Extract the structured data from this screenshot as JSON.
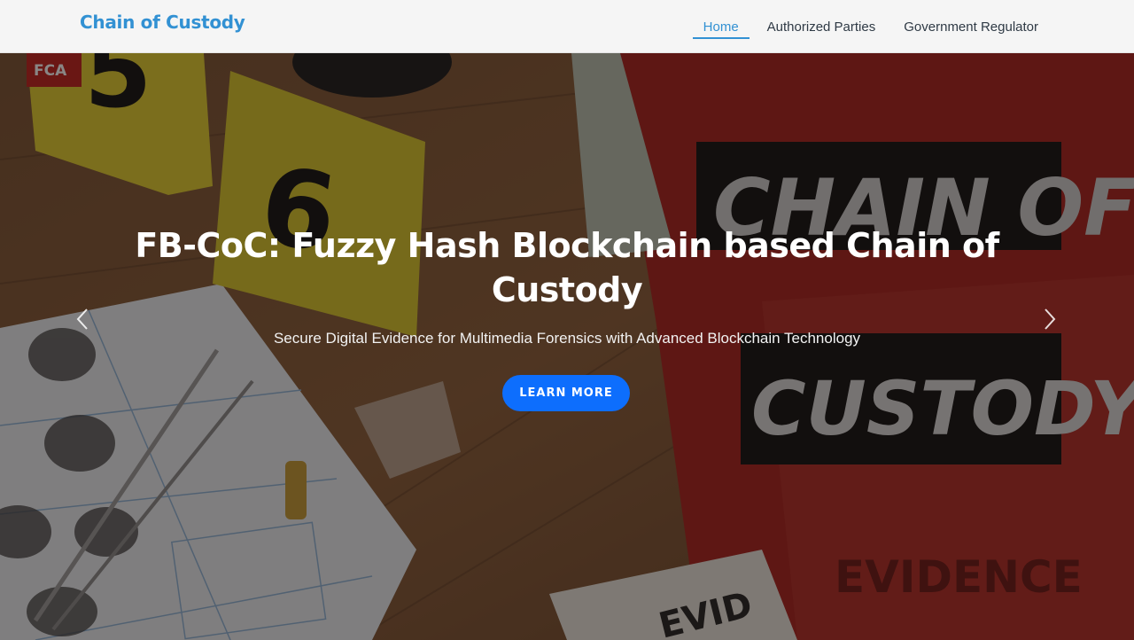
{
  "navbar": {
    "brand": "Chain of Custody",
    "links": [
      {
        "label": "Home",
        "active": true
      },
      {
        "label": "Authorized Parties",
        "active": false
      },
      {
        "label": "Government Regulator",
        "active": false
      }
    ]
  },
  "hero": {
    "title": "FB-CoC: Fuzzy Hash Blockchain based Chain of Custody",
    "subtitle": "Secure Digital Evidence for Multimedia Forensics with Advanced Blockchain Technology",
    "cta_label": "LEARN MORE",
    "prev_icon": "chevron-left-icon",
    "next_icon": "chevron-right-icon",
    "background_image_text": {
      "panel_line_1": "CHAIN OF",
      "panel_line_2": "CUSTODY",
      "evidence_label": "EVIDENCE",
      "evidence_bag": "EVID",
      "marker_5": "5",
      "marker_6": "6",
      "fca_tag": "FCA"
    }
  },
  "colors": {
    "brand": "#3291d3",
    "cta": "#0d6efd",
    "navbar_bg": "#f5f5f5"
  }
}
